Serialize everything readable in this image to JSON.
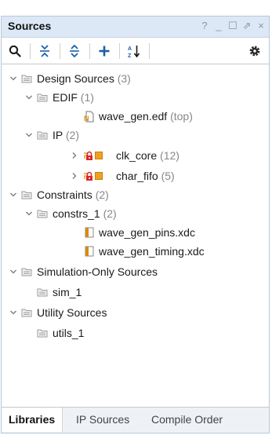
{
  "window": {
    "title": "Sources",
    "controls": [
      "?",
      "_",
      "☐",
      "⇗",
      "×"
    ]
  },
  "toolbar": {
    "icons": [
      "search-icon",
      "collapse-all-icon",
      "expand-all-icon",
      "add-icon",
      "sort-icon",
      "gear-icon"
    ]
  },
  "tree": {
    "design_sources": {
      "label": "Design Sources",
      "count": "(3)"
    },
    "edif": {
      "label": "EDIF",
      "count": "(1)"
    },
    "wave_gen_edf": {
      "label": "wave_gen.edf",
      "count": "(top)"
    },
    "ip": {
      "label": "IP",
      "count": "(2)"
    },
    "clk_core": {
      "label": "clk_core",
      "count": "(12)"
    },
    "char_fifo": {
      "label": "char_fifo",
      "count": "(5)"
    },
    "constraints": {
      "label": "Constraints",
      "count": "(2)"
    },
    "constrs_1": {
      "label": "constrs_1",
      "count": "(2)"
    },
    "pins_xdc": {
      "label": "wave_gen_pins.xdc"
    },
    "timing_xdc": {
      "label": "wave_gen_timing.xdc"
    },
    "sim_sources": {
      "label": "Simulation-Only Sources"
    },
    "sim_1": {
      "label": "sim_1"
    },
    "utility_sources": {
      "label": "Utility Sources"
    },
    "utils_1": {
      "label": "utils_1"
    }
  },
  "tabs": [
    {
      "label": "Libraries",
      "active": true
    },
    {
      "label": "IP Sources",
      "active": false
    },
    {
      "label": "Compile Order",
      "active": false
    }
  ],
  "colors": {
    "title_bar": "#dce8f5",
    "accent_blue": "#1a5fa8",
    "folder_gray": "#9a9a9a",
    "lock_red": "#d9262c",
    "ip_orange": "#f0a020",
    "xdc_orange": "#d88a10"
  }
}
